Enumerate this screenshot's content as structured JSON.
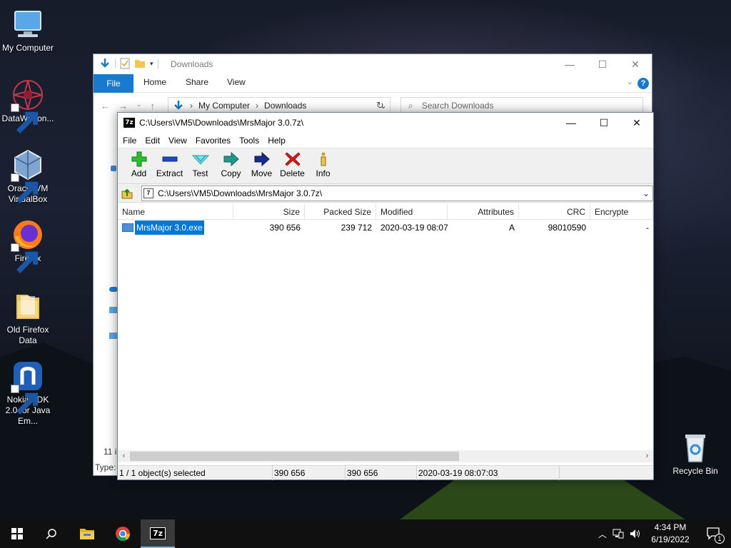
{
  "desktop": {
    "icons": [
      {
        "label": "My Computer"
      },
      {
        "label": "DataWagon..."
      },
      {
        "label": "Oracle VM VirtualBox"
      },
      {
        "label": "Firefox"
      },
      {
        "label": "Old Firefox Data"
      },
      {
        "label": "Nokia SDK 2.0 for Java Em..."
      },
      {
        "label": "Recycle Bin"
      }
    ]
  },
  "explorer": {
    "title": "Downloads",
    "tabs": [
      "File",
      "Home",
      "Share",
      "View"
    ],
    "help": "?",
    "breadcrumb": [
      "My Computer",
      "Downloads"
    ],
    "search_placeholder": "Search Downloads",
    "status": "11 i",
    "type_label": "Type:"
  },
  "sevenzip": {
    "logo": "7z",
    "title": "C:\\Users\\VM5\\Downloads\\MrsMajor 3.0.7z\\",
    "menu": [
      "File",
      "Edit",
      "View",
      "Favorites",
      "Tools",
      "Help"
    ],
    "toolbar": [
      "Add",
      "Extract",
      "Test",
      "Copy",
      "Move",
      "Delete",
      "Info"
    ],
    "path": "C:\\Users\\VM5\\Downloads\\MrsMajor 3.0.7z\\",
    "columns": [
      "Name",
      "Size",
      "Packed Size",
      "Modified",
      "Attributes",
      "CRC",
      "Encrypte"
    ],
    "rows": [
      {
        "name": "MrsMajor 3.0.exe",
        "size": "390 656",
        "packed": "239 712",
        "modified": "2020-03-19 08:07",
        "attributes": "A",
        "crc": "98010590",
        "encrypted": "-"
      }
    ],
    "statusbar": {
      "selected": "1 / 1 object(s) selected",
      "size": "390 656",
      "packed": "390 656",
      "modified": "2020-03-19 08:07:03"
    }
  },
  "taskbar": {
    "time": "4:34 PM",
    "date": "6/19/2022",
    "notification_count": "1",
    "active_app_label": "7z"
  },
  "colors": {
    "accent": "#1979ca",
    "selection": "#0078d7",
    "taskbar": "#101010"
  }
}
